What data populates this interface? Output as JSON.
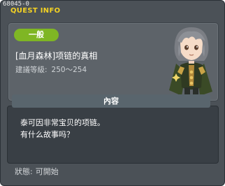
{
  "titlebar": {
    "quest_id": "68045-0",
    "title": "QUEST INFO"
  },
  "quest": {
    "category_tag": "一般",
    "name": "[血月森林]项链的真相",
    "level_label": "建議等級:",
    "level_range": "250～254",
    "npc_icon": "npc-character-portrait"
  },
  "content": {
    "header": "內容",
    "description_line1": "泰可因非常宝贝的项链。",
    "description_line2": "有什么故事吗？"
  },
  "status": {
    "label": "狀態:",
    "value": "可開始"
  },
  "colors": {
    "title": "#f4d223",
    "tag": "#7fb624",
    "window_bg": "#4b5157"
  }
}
